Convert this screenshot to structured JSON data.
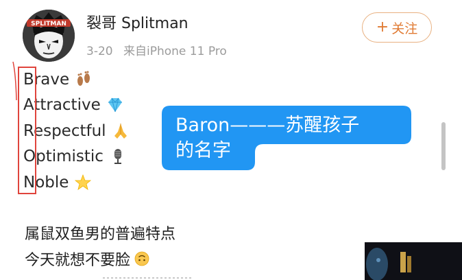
{
  "post": {
    "username": "裂哥 Splitman",
    "date": "3-20",
    "source": "来自iPhone 11 Pro",
    "avatar_text": "SPLITMAN",
    "follow_label": "关注",
    "follow_icon": "plus-icon"
  },
  "acrostic": [
    {
      "word": "Brave",
      "emoji": "footprints-icon"
    },
    {
      "word": "Attractive",
      "emoji": "gem-icon"
    },
    {
      "word": "Respectful",
      "emoji": "folded-hands-icon"
    },
    {
      "word": "Optimistic",
      "emoji": "microphone-icon"
    },
    {
      "word": "Noble",
      "emoji": "star-icon"
    }
  ],
  "annotation": {
    "line1": "Baron———苏醒孩子",
    "line2": "的名字",
    "bubble_color": "#2196f3",
    "box_color": "#e0443c"
  },
  "body": {
    "line1": "属鼠双鱼男的普遍特点",
    "line2": "今天就想不要脸",
    "line2_emoji": "upside-down-face-icon"
  }
}
